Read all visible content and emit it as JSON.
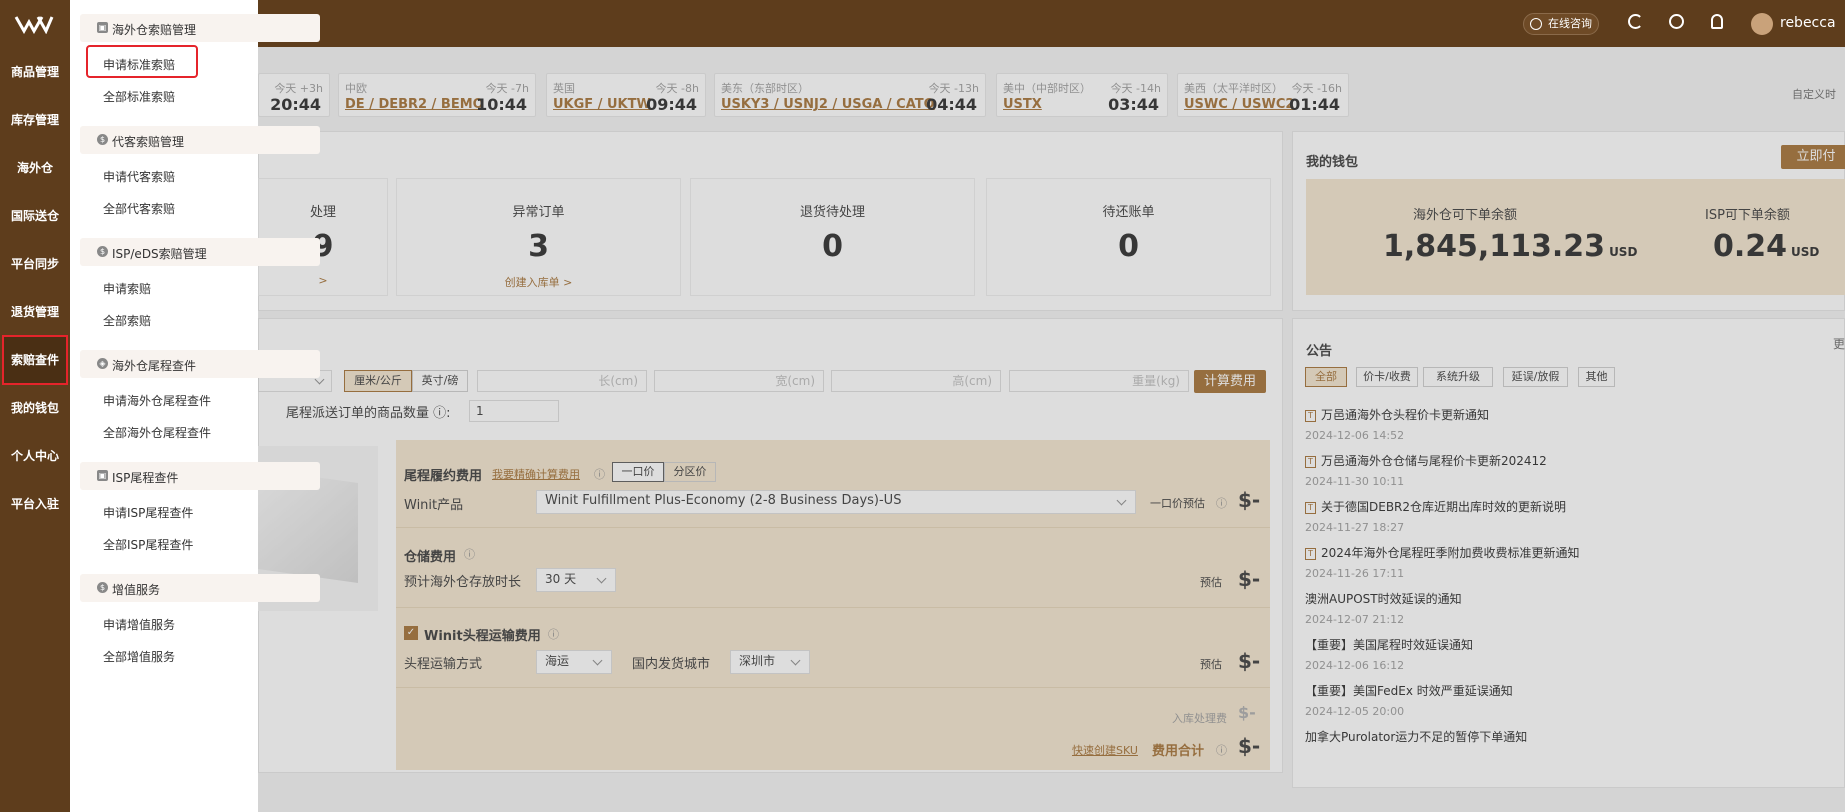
{
  "header": {
    "online_consult": "在线咨询",
    "user": "rebecca"
  },
  "nav": [
    {
      "label": "商品管理"
    },
    {
      "label": "库存管理"
    },
    {
      "label": "海外仓"
    },
    {
      "label": "国际送仓"
    },
    {
      "label": "平台同步"
    },
    {
      "label": "退货管理"
    },
    {
      "label": "索赔查件"
    },
    {
      "label": "我的钱包"
    },
    {
      "label": "个人中心"
    },
    {
      "label": "平台入驻"
    }
  ],
  "submenu": {
    "groups": [
      {
        "title": "海外仓索赔管理",
        "links": [
          "申请标准索赔",
          "全部标准索赔"
        ]
      },
      {
        "title": "代客索赔管理",
        "links": [
          "申请代客索赔",
          "全部代客索赔"
        ]
      },
      {
        "title": "ISP/eDS索赔管理",
        "links": [
          "申请索赔",
          "全部索赔"
        ]
      },
      {
        "title": "海外仓尾程查件",
        "links": [
          "申请海外仓尾程查件",
          "全部海外仓尾程查件"
        ]
      },
      {
        "title": "ISP尾程查件",
        "links": [
          "申请ISP尾程查件",
          "全部ISP尾程查件"
        ]
      },
      {
        "title": "增值服务",
        "links": [
          "申请增值服务",
          "全部增值服务"
        ]
      }
    ]
  },
  "timezones": [
    {
      "region": "",
      "rel": "今天 +3h",
      "codes": "",
      "time": "20:44"
    },
    {
      "region": "中欧",
      "rel": "今天 -7h",
      "codes": "DE / DEBR2 / BEMO",
      "time": "10:44"
    },
    {
      "region": "英国",
      "rel": "今天 -8h",
      "codes": "UKGF / UKTW",
      "time": "09:44"
    },
    {
      "region": "美东（东部时区）",
      "rel": "今天 -13h",
      "codes": "USKY3 / USNJ2 / USGA / CATO",
      "time": "04:44"
    },
    {
      "region": "美中（中部时区）",
      "rel": "今天 -14h",
      "codes": "USTX",
      "time": "03:44"
    },
    {
      "region": "美西（太平洋时区）",
      "rel": "今天 -16h",
      "codes": "USWC / USWC2",
      "time": "01:44"
    }
  ],
  "custom_time": "自定义时",
  "stats": [
    {
      "label": "处理",
      "num": "9",
      "link": ">"
    },
    {
      "label": "异常订单",
      "num": "3",
      "link": "创建入库单 >"
    },
    {
      "label": "退货待处理",
      "num": "0",
      "link": ""
    },
    {
      "label": "待还账单",
      "num": "0",
      "link": ""
    }
  ],
  "wallet": {
    "title": "我的钱包",
    "topup": "立即付",
    "a_label": "海外仓可下单余额",
    "a_value": "1,845,113.23",
    "a_unit": "USD",
    "b_label": "ISP可下单余额",
    "b_value": "0.24",
    "b_unit": "USD"
  },
  "calc": {
    "unit_metric": "厘米/公斤",
    "unit_imperial": "英寸/磅",
    "len_ph": "长(cm)",
    "wid_ph": "宽(cm)",
    "hei_ph": "高(cm)",
    "wei_ph": "重量(kg)",
    "calc_btn": "计算费用",
    "qty_label": "尾程派送订单的商品数量",
    "qty_value": "1",
    "lastmile_title": "尾程履约费用",
    "precise_link": "我要精确计算费用",
    "tab_flat": "一口价",
    "tab_zone": "分区价",
    "product_label": "Winit产品",
    "product_value": "Winit Fulfillment Plus-Economy (2-8 Business Days)-US",
    "flat_est": "一口价预估",
    "storage_title": "仓储费用",
    "storage_label": "预计海外仓存放时长",
    "storage_value": "30 天",
    "est": "预估",
    "headhaul_title": "Winit头程运输费用",
    "mode_label": "头程运输方式",
    "mode_value": "海运",
    "city_label": "国内发货城市",
    "city_value": "深圳市",
    "inbound_fee": "入库处理费",
    "quick_sku": "快速创建SKU",
    "total": "费用合计",
    "dollar": "$-"
  },
  "notice": {
    "title": "公告",
    "more": "更",
    "tabs": [
      "全部",
      "价卡/收费",
      "系统升级",
      "延误/放假",
      "其他"
    ],
    "items": [
      {
        "text": "万邑通海外仓头程价卡更新通知",
        "date": "2024-12-06 14:52",
        "pin": true
      },
      {
        "text": "万邑通海外仓仓储与尾程价卡更新202412",
        "date": "2024-11-30 10:11",
        "pin": true
      },
      {
        "text": "关于德国DEBR2仓库近期出库时效的更新说明",
        "date": "2024-11-27 18:27",
        "pin": true
      },
      {
        "text": "2024年海外仓尾程旺季附加费收费标准更新通知",
        "date": "2024-11-26 17:11",
        "pin": true
      },
      {
        "text": "澳洲AUPOST时效延误的通知",
        "date": "2024-12-07 21:12",
        "pin": false
      },
      {
        "text": "【重要】美国尾程时效延误通知",
        "date": "2024-12-06 16:12",
        "pin": false
      },
      {
        "text": "【重要】美国FedEx 时效严重延误通知",
        "date": "2024-12-05 20:00",
        "pin": false
      },
      {
        "text": "加拿大Purolator运力不足的暂停下单通知",
        "date": "",
        "pin": false
      }
    ]
  }
}
